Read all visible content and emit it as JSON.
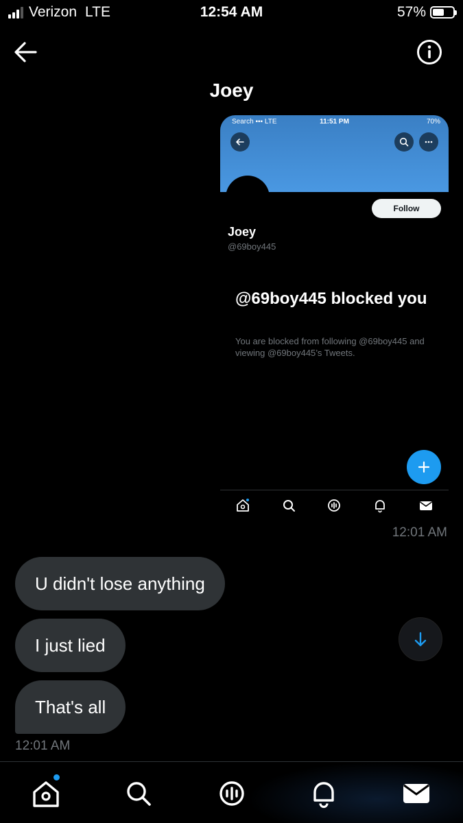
{
  "status_bar": {
    "carrier": "Verizon",
    "network": "LTE",
    "time": "12:54 AM",
    "battery": "57%",
    "battery_level": 0.57
  },
  "header": {
    "title": "Joey"
  },
  "shared_screenshot": {
    "status": {
      "left": "Search",
      "network": "LTE",
      "time": "11:51 PM",
      "battery": "70%"
    },
    "follow_label": "Follow",
    "name": "Joey",
    "handle": "@69boy445",
    "blocked_title": "@69boy445 blocked you",
    "blocked_desc": "You are blocked from following @69boy445 and viewing @69boy445’s Tweets.",
    "accent": "#1d9bf0"
  },
  "messages": {
    "sent_time": "12:01 AM",
    "received": [
      {
        "text": "U didn't lose anything"
      },
      {
        "text": "I just lied"
      },
      {
        "text": "That's all"
      }
    ],
    "received_time": "12:01 AM"
  },
  "bottom_nav": {
    "items": [
      "home-icon",
      "search-icon",
      "spaces-icon",
      "notifications-icon",
      "messages-icon"
    ]
  },
  "colors": {
    "background": "#000000",
    "bubble": "#2f3336",
    "muted": "#71767b",
    "accent": "#1d9bf0"
  }
}
